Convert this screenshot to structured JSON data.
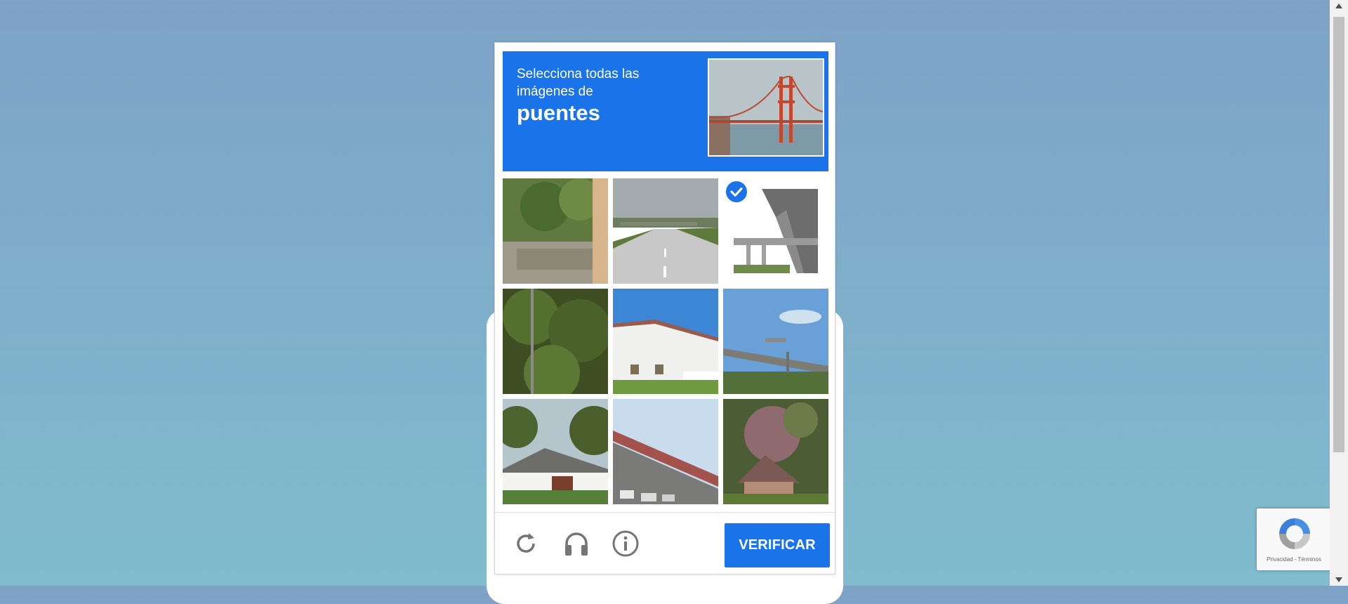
{
  "challenge": {
    "instruction_line1": "Selecciona todas las imágenes de",
    "target_word": "puentes",
    "sample_image_icon": "golden-gate-bridge-photo"
  },
  "grid": {
    "tiles": [
      {
        "index": 1,
        "subject": "tree-and-fence-photo",
        "selected": false
      },
      {
        "index": 2,
        "subject": "highway-overpass-photo",
        "selected": false
      },
      {
        "index": 3,
        "subject": "elevated-highway-underside-photo",
        "selected": true
      },
      {
        "index": 4,
        "subject": "trees-and-pole-photo",
        "selected": false
      },
      {
        "index": 5,
        "subject": "white-building-photo",
        "selected": false
      },
      {
        "index": 6,
        "subject": "overpass-sky-photo",
        "selected": false
      },
      {
        "index": 7,
        "subject": "house-with-trees-photo",
        "selected": false
      },
      {
        "index": 8,
        "subject": "bridge-underside-parking-photo",
        "selected": false
      },
      {
        "index": 9,
        "subject": "flowering-tree-roof-photo",
        "selected": false
      }
    ]
  },
  "footer": {
    "reload_icon": "reload-icon",
    "audio_icon": "headphones-icon",
    "info_icon": "info-icon",
    "verify_label": "VERIFICAR"
  },
  "badge": {
    "text": "Privacidad - Términos"
  },
  "colors": {
    "accent": "#1a73e8",
    "background_top": "#7ea2c6",
    "background_bottom": "#80bccd"
  }
}
